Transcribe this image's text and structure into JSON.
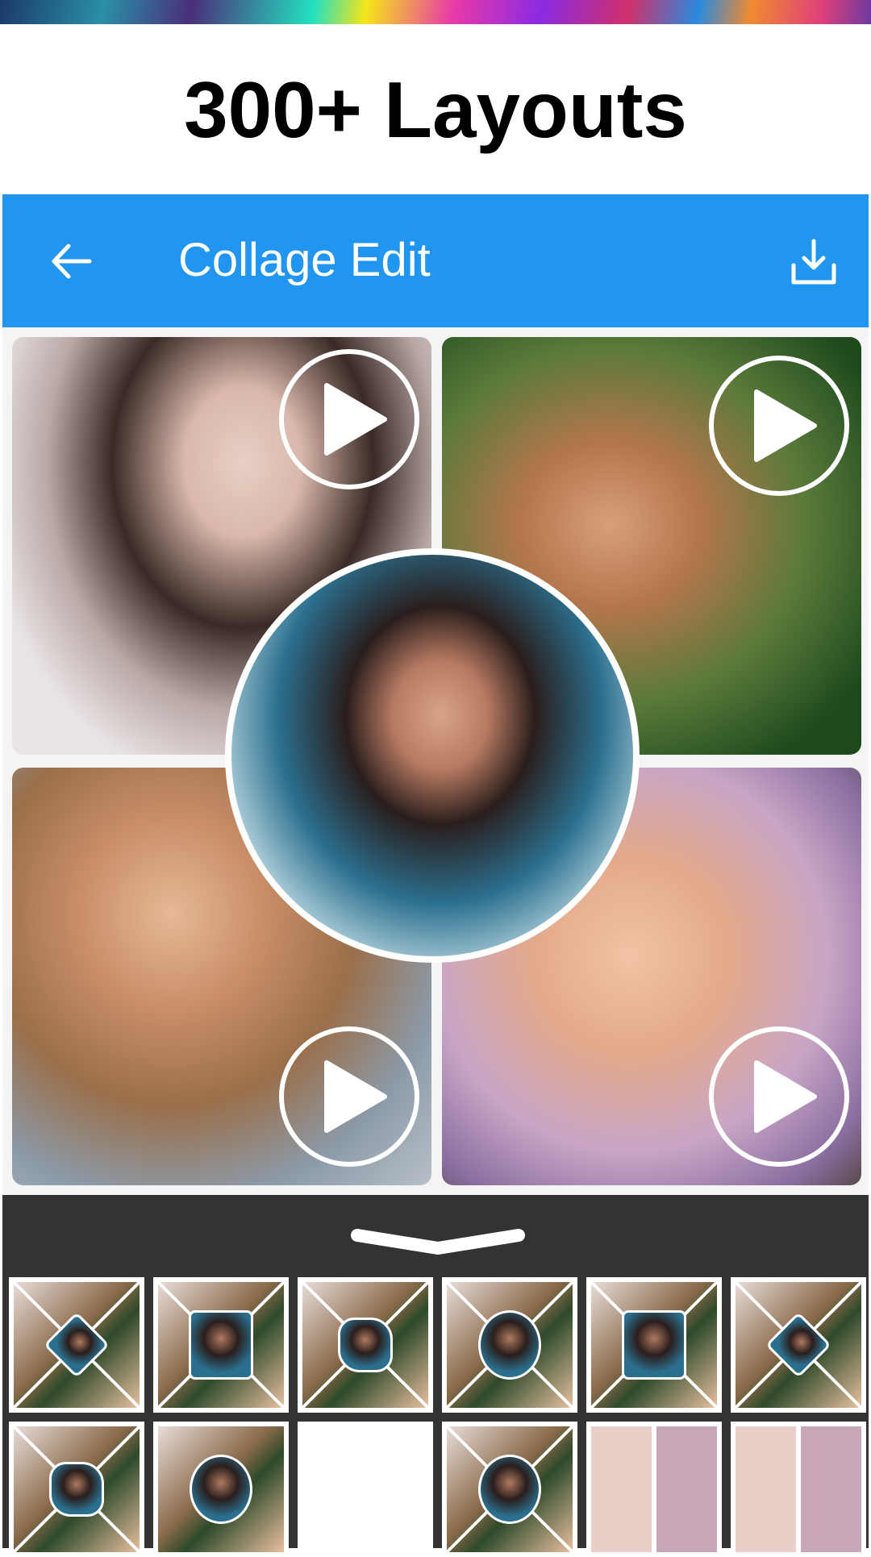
{
  "promo": {
    "headline": "300+ Layouts"
  },
  "appbar": {
    "title": "Collage Edit",
    "back_icon": "arrow-left-icon",
    "download_icon": "download-icon"
  },
  "collage": {
    "cells": [
      {
        "name": "photo-woman-dark-hair",
        "has_play": true
      },
      {
        "name": "photo-girl-yellow-bow",
        "has_play": true
      },
      {
        "name": "photo-woman-curly-hair",
        "has_play": true
      },
      {
        "name": "photo-baby-blanket",
        "has_play": true
      }
    ],
    "center_photo": "photo-woman-center-circle"
  },
  "layout_sheet": {
    "collapse_icon": "chevron-down-icon",
    "layouts": [
      {
        "shape": "diamond"
      },
      {
        "shape": "rounded-square"
      },
      {
        "shape": "wavy"
      },
      {
        "shape": "circle"
      },
      {
        "shape": "rounded-rect"
      },
      {
        "shape": "diamond"
      },
      {
        "shape": "wavy"
      },
      {
        "shape": "grid-circle"
      },
      {
        "shape": "hearts"
      },
      {
        "shape": "circle"
      },
      {
        "shape": "grid"
      },
      {
        "shape": "grid-large"
      }
    ]
  },
  "colors": {
    "appbar": "#2196f0",
    "sheet": "#333333"
  }
}
